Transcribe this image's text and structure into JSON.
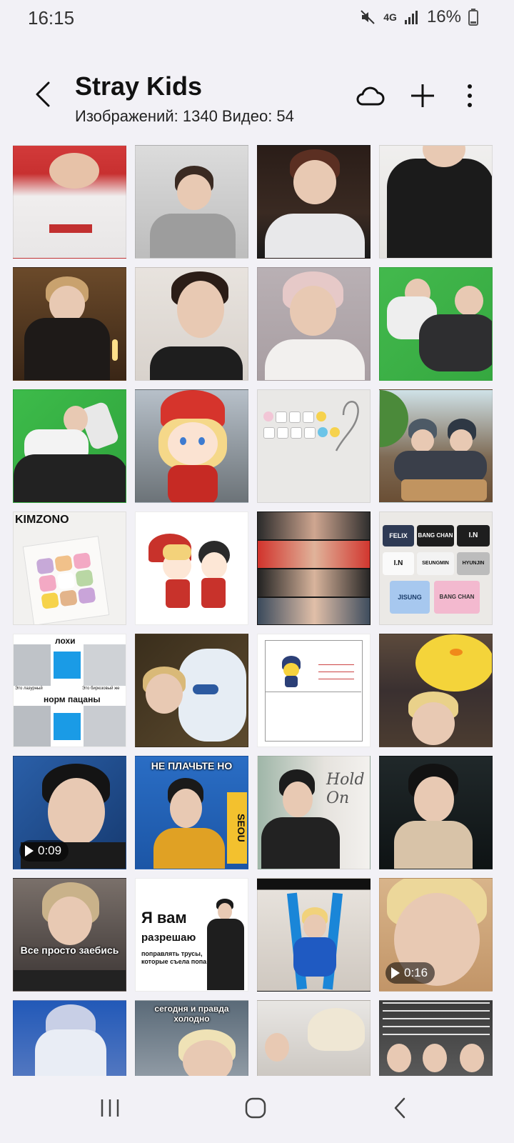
{
  "status": {
    "time": "16:15",
    "network": "4G",
    "battery": "16%"
  },
  "header": {
    "title": "Stray Kids",
    "subtitle": "Изображений: 1340 Видео: 54"
  },
  "thumbnails": {
    "t13_logo": "KIMZONO",
    "t16_labels": [
      "FELIX",
      "BANG CHAN",
      "I.N",
      "I.N",
      "SEUNGMIN",
      "HYUNJIN",
      "JISUNG",
      "BANG CHAN"
    ],
    "t17_top": "лохи",
    "t17_mid1": "Это лазурный",
    "t17_mid2": "Это бирюзовый же",
    "t17_bottom": "норм пацаны",
    "t21_duration": "0:09",
    "t22_caption": "НЕ ПЛАЧЬТЕ НО",
    "t22_side": "SEOU",
    "t23_title": "Hold On",
    "t25_caption": "Все просто заебись",
    "t26_big1": "Я вам",
    "t26_big2": "разрешаю",
    "t26_small": "поправлять трусы, которые съела попа",
    "t28_duration": "0:16",
    "t30_caption": "сегодня и правда холодно"
  },
  "accent": "#1a9be6"
}
